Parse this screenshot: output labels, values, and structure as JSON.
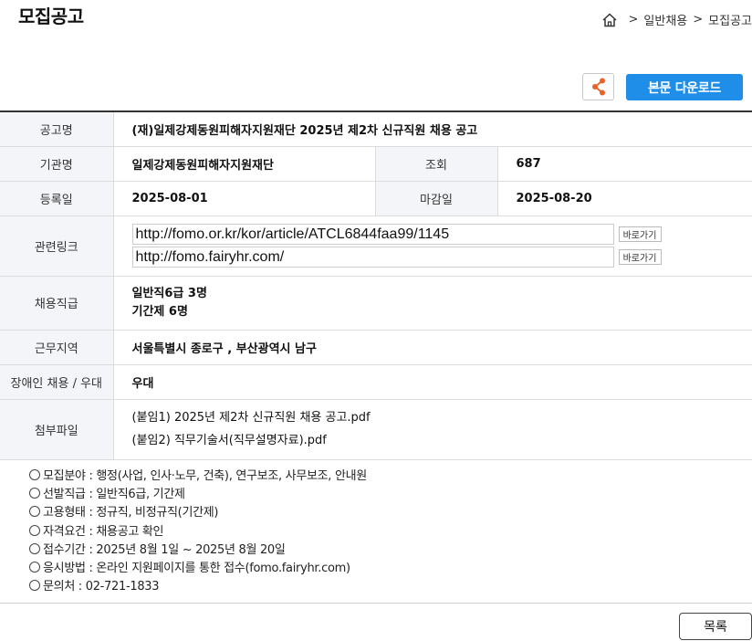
{
  "page_title": "모집공고",
  "breadcrumb": {
    "items": [
      "일반채용",
      "모집공고"
    ],
    "separator": ">"
  },
  "actions": {
    "download_label": "본문 다운로드",
    "accent_color": "#1f8ee8"
  },
  "info": {
    "title_label": "공고명",
    "title_value": "(재)일제강제동원피해자지원재단 2025년 제2차 신규직원 채용 공고",
    "org_label": "기관명",
    "org_value": "일제강제동원피해자지원재단",
    "views_label": "조회",
    "views_value": "687",
    "reg_label": "등록일",
    "reg_value": "2025-08-01",
    "deadline_label": "마감일",
    "deadline_value": "2025-08-20",
    "links_label": "관련링크",
    "links": [
      "http://fomo.or.kr/kor/article/ATCL6844faa99/1145",
      "http://fomo.fairyhr.com/"
    ],
    "go_label": "바로가기",
    "positions_label": "채용직급",
    "positions": [
      "일반직6급 3명",
      "기간제 6명"
    ],
    "region_label": "근무지역",
    "region_value": "서울특별시 종로구 , 부산광역시 남구",
    "disabled_label": "장애인 채용 / 우대",
    "disabled_value": "우대",
    "files_label": "첨부파일",
    "files": [
      "(붙임1) 2025년 제2차 신규직원 채용 공고.pdf",
      "(붙임2) 직무기술서(직무설명자료).pdf"
    ]
  },
  "details": [
    "모집분야 : 행정(사업, 인사·노무, 건축), 연구보조, 사무보조, 안내원",
    "선발직급 : 일반직6급, 기간제",
    "고용형태 : 정규직, 비정규직(기간제)",
    "자격요건 : 채용공고 확인",
    "접수기간 : 2025년 8월 1일 ~ 2025년 8월 20일",
    "응시방법 : 온라인 지원페이지를 통한 접수(fomo.fairyhr.com)",
    "문의처 : 02-721-1833"
  ],
  "list_button_label": "목록"
}
